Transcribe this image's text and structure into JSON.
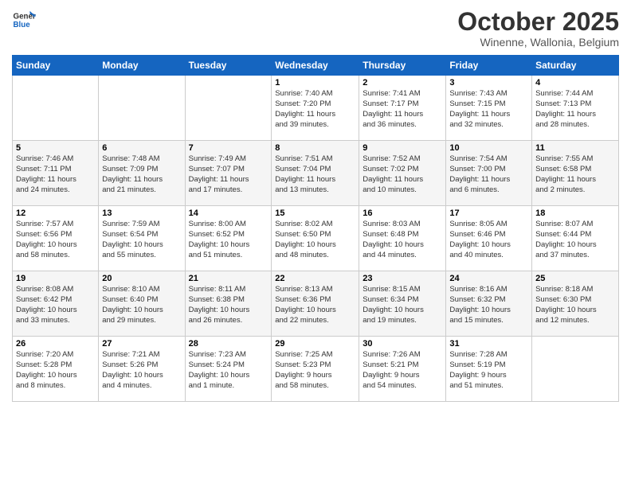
{
  "header": {
    "logo_line1": "General",
    "logo_line2": "Blue",
    "month": "October 2025",
    "location": "Winenne, Wallonia, Belgium"
  },
  "days_of_week": [
    "Sunday",
    "Monday",
    "Tuesday",
    "Wednesday",
    "Thursday",
    "Friday",
    "Saturday"
  ],
  "weeks": [
    [
      {
        "num": "",
        "info": ""
      },
      {
        "num": "",
        "info": ""
      },
      {
        "num": "",
        "info": ""
      },
      {
        "num": "1",
        "info": "Sunrise: 7:40 AM\nSunset: 7:20 PM\nDaylight: 11 hours\nand 39 minutes."
      },
      {
        "num": "2",
        "info": "Sunrise: 7:41 AM\nSunset: 7:17 PM\nDaylight: 11 hours\nand 36 minutes."
      },
      {
        "num": "3",
        "info": "Sunrise: 7:43 AM\nSunset: 7:15 PM\nDaylight: 11 hours\nand 32 minutes."
      },
      {
        "num": "4",
        "info": "Sunrise: 7:44 AM\nSunset: 7:13 PM\nDaylight: 11 hours\nand 28 minutes."
      }
    ],
    [
      {
        "num": "5",
        "info": "Sunrise: 7:46 AM\nSunset: 7:11 PM\nDaylight: 11 hours\nand 24 minutes."
      },
      {
        "num": "6",
        "info": "Sunrise: 7:48 AM\nSunset: 7:09 PM\nDaylight: 11 hours\nand 21 minutes."
      },
      {
        "num": "7",
        "info": "Sunrise: 7:49 AM\nSunset: 7:07 PM\nDaylight: 11 hours\nand 17 minutes."
      },
      {
        "num": "8",
        "info": "Sunrise: 7:51 AM\nSunset: 7:04 PM\nDaylight: 11 hours\nand 13 minutes."
      },
      {
        "num": "9",
        "info": "Sunrise: 7:52 AM\nSunset: 7:02 PM\nDaylight: 11 hours\nand 10 minutes."
      },
      {
        "num": "10",
        "info": "Sunrise: 7:54 AM\nSunset: 7:00 PM\nDaylight: 11 hours\nand 6 minutes."
      },
      {
        "num": "11",
        "info": "Sunrise: 7:55 AM\nSunset: 6:58 PM\nDaylight: 11 hours\nand 2 minutes."
      }
    ],
    [
      {
        "num": "12",
        "info": "Sunrise: 7:57 AM\nSunset: 6:56 PM\nDaylight: 10 hours\nand 58 minutes."
      },
      {
        "num": "13",
        "info": "Sunrise: 7:59 AM\nSunset: 6:54 PM\nDaylight: 10 hours\nand 55 minutes."
      },
      {
        "num": "14",
        "info": "Sunrise: 8:00 AM\nSunset: 6:52 PM\nDaylight: 10 hours\nand 51 minutes."
      },
      {
        "num": "15",
        "info": "Sunrise: 8:02 AM\nSunset: 6:50 PM\nDaylight: 10 hours\nand 48 minutes."
      },
      {
        "num": "16",
        "info": "Sunrise: 8:03 AM\nSunset: 6:48 PM\nDaylight: 10 hours\nand 44 minutes."
      },
      {
        "num": "17",
        "info": "Sunrise: 8:05 AM\nSunset: 6:46 PM\nDaylight: 10 hours\nand 40 minutes."
      },
      {
        "num": "18",
        "info": "Sunrise: 8:07 AM\nSunset: 6:44 PM\nDaylight: 10 hours\nand 37 minutes."
      }
    ],
    [
      {
        "num": "19",
        "info": "Sunrise: 8:08 AM\nSunset: 6:42 PM\nDaylight: 10 hours\nand 33 minutes."
      },
      {
        "num": "20",
        "info": "Sunrise: 8:10 AM\nSunset: 6:40 PM\nDaylight: 10 hours\nand 29 minutes."
      },
      {
        "num": "21",
        "info": "Sunrise: 8:11 AM\nSunset: 6:38 PM\nDaylight: 10 hours\nand 26 minutes."
      },
      {
        "num": "22",
        "info": "Sunrise: 8:13 AM\nSunset: 6:36 PM\nDaylight: 10 hours\nand 22 minutes."
      },
      {
        "num": "23",
        "info": "Sunrise: 8:15 AM\nSunset: 6:34 PM\nDaylight: 10 hours\nand 19 minutes."
      },
      {
        "num": "24",
        "info": "Sunrise: 8:16 AM\nSunset: 6:32 PM\nDaylight: 10 hours\nand 15 minutes."
      },
      {
        "num": "25",
        "info": "Sunrise: 8:18 AM\nSunset: 6:30 PM\nDaylight: 10 hours\nand 12 minutes."
      }
    ],
    [
      {
        "num": "26",
        "info": "Sunrise: 7:20 AM\nSunset: 5:28 PM\nDaylight: 10 hours\nand 8 minutes."
      },
      {
        "num": "27",
        "info": "Sunrise: 7:21 AM\nSunset: 5:26 PM\nDaylight: 10 hours\nand 4 minutes."
      },
      {
        "num": "28",
        "info": "Sunrise: 7:23 AM\nSunset: 5:24 PM\nDaylight: 10 hours\nand 1 minute."
      },
      {
        "num": "29",
        "info": "Sunrise: 7:25 AM\nSunset: 5:23 PM\nDaylight: 9 hours\nand 58 minutes."
      },
      {
        "num": "30",
        "info": "Sunrise: 7:26 AM\nSunset: 5:21 PM\nDaylight: 9 hours\nand 54 minutes."
      },
      {
        "num": "31",
        "info": "Sunrise: 7:28 AM\nSunset: 5:19 PM\nDaylight: 9 hours\nand 51 minutes."
      },
      {
        "num": "",
        "info": ""
      }
    ]
  ]
}
